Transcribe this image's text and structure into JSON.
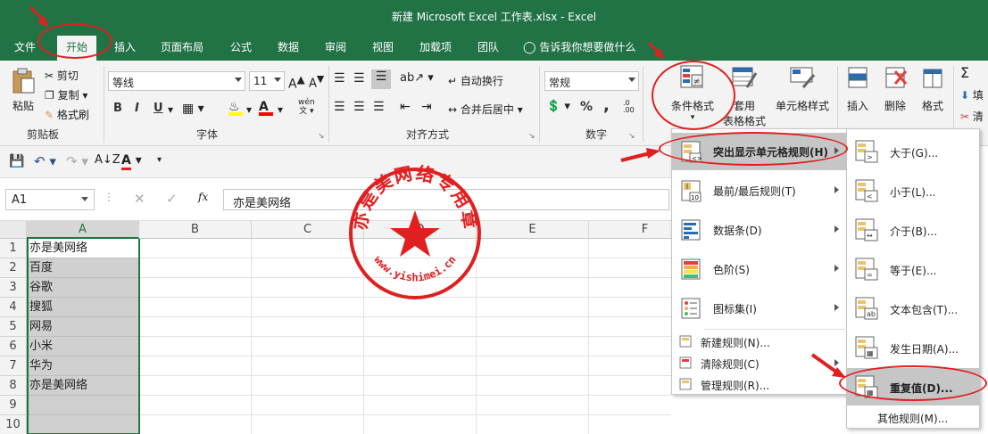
{
  "window": {
    "title": "新建 Microsoft Excel 工作表.xlsx  -  Excel"
  },
  "tabs": [
    {
      "label": "文件"
    },
    {
      "label": "开始"
    },
    {
      "label": "插入"
    },
    {
      "label": "页面布局"
    },
    {
      "label": "公式"
    },
    {
      "label": "数据"
    },
    {
      "label": "审阅"
    },
    {
      "label": "视图"
    },
    {
      "label": "加载项"
    },
    {
      "label": "团队"
    }
  ],
  "tell_me": "告诉我你想要做什么",
  "ribbon": {
    "clipboard": {
      "paste": "粘贴",
      "cut": "剪切",
      "copy": "复制",
      "format_painter": "格式刷",
      "group": "剪贴板"
    },
    "font": {
      "name": "等线",
      "size": "11",
      "group": "字体",
      "bold": "B",
      "italic": "I",
      "underline": "U",
      "wen": "wén"
    },
    "align": {
      "wrap": "自动换行",
      "merge": "合并后居中",
      "group": "对齐方式"
    },
    "number": {
      "format": "常规",
      "group": "数字",
      "percent": "%",
      "comma": ","
    },
    "styles": {
      "conditional": "条件格式",
      "table_line1": "套用",
      "table_line2": "表格格式",
      "cell_style": "单元格样式"
    },
    "cells": {
      "insert": "插入",
      "delete": "删除",
      "format": "格式"
    },
    "edit": {
      "fill": "填",
      "clear": "清"
    }
  },
  "formula_bar": {
    "name_box": "A1",
    "fx": "fx",
    "content": "亦是美网络"
  },
  "sheet": {
    "columns": [
      "A",
      "B",
      "C",
      "D",
      "E",
      "F"
    ],
    "rows": [
      "1",
      "2",
      "3",
      "4",
      "5",
      "6",
      "7",
      "8",
      "9",
      "10"
    ],
    "col_a": [
      "亦是美网络",
      "百度",
      "谷歌",
      "搜狐",
      "网易",
      "小米",
      "华为",
      "亦是美网络",
      "",
      ""
    ]
  },
  "cf_menu": {
    "items": [
      {
        "label": "突出显示单元格规则(H)",
        "icon": "highlight-rules-icon"
      },
      {
        "label": "最前/最后规则(T)",
        "icon": "top-bottom-icon"
      },
      {
        "label": "数据条(D)",
        "icon": "data-bars-icon"
      },
      {
        "label": "色阶(S)",
        "icon": "color-scales-icon"
      },
      {
        "label": "图标集(I)",
        "icon": "icon-sets-icon"
      }
    ],
    "small": [
      {
        "label": "新建规则(N)..."
      },
      {
        "label": "清除规则(C)"
      },
      {
        "label": "管理规则(R)..."
      }
    ]
  },
  "sub_menu": {
    "items": [
      {
        "label": "大于(G)..."
      },
      {
        "label": "小于(L)..."
      },
      {
        "label": "介于(B)..."
      },
      {
        "label": "等于(E)..."
      },
      {
        "label": "文本包含(T)..."
      },
      {
        "label": "发生日期(A)..."
      },
      {
        "label": "重复值(D)..."
      }
    ],
    "more": "其他规则(M)..."
  },
  "stamp": {
    "top": "亦是美网络专用章",
    "bottom": "www.yishimei.cn"
  },
  "colors": {
    "excel_green": "#217346",
    "annotation_red": "#e02020",
    "selection_gray": "#d0d0d0",
    "menu_highlight": "#c6c6c6"
  }
}
